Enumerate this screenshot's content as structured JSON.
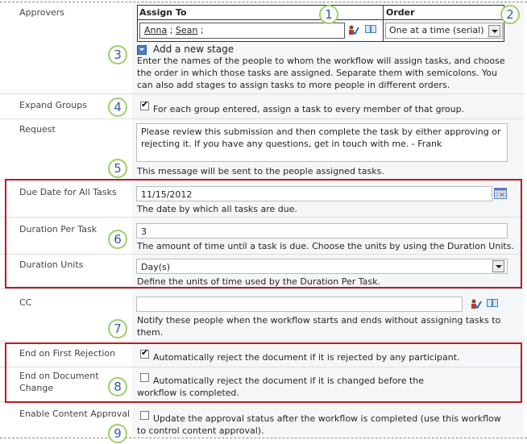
{
  "approvers": {
    "label": "Approvers",
    "table": {
      "assign_to_header": "Assign To",
      "order_header": "Order",
      "assignees": [
        "Anna",
        "Sean"
      ],
      "separator": " ; ",
      "order_value": "One at a time (serial)"
    },
    "add_stage_label": "Add a new stage",
    "description": "Enter the names of the people to whom the workflow will assign tasks, and choose the order in which those tasks are assigned. Separate them with semicolons. You can also add stages to assign tasks to more people in different orders."
  },
  "expand_groups": {
    "label": "Expand Groups",
    "checked": true,
    "text": "For each group entered, assign a task to every member of that group."
  },
  "request": {
    "label": "Request",
    "value": "Please review this submission and then complete the task by either approving or rejecting it. If you have any questions, get in touch with me. - Frank",
    "description": "This message will be sent to the people assigned tasks."
  },
  "due_date": {
    "label": "Due Date for All Tasks",
    "value": "11/15/2012",
    "description": "The date by which all tasks are due."
  },
  "duration_per_task": {
    "label": "Duration Per Task",
    "value": "3",
    "description": "The amount of time until a task is due. Choose the units by using the Duration Units."
  },
  "duration_units": {
    "label": "Duration Units",
    "value": "Day(s)",
    "description": "Define the units of time used by the Duration Per Task."
  },
  "cc": {
    "label": "CC",
    "value": "",
    "description": "Notify these people when the workflow starts and ends without assigning tasks to them."
  },
  "end_on_first_rejection": {
    "label": "End on First Rejection",
    "checked": true,
    "text": "Automatically reject the document if it is rejected by any participant."
  },
  "end_on_document_change": {
    "label": "End on Document Change",
    "checked": false,
    "text": "Automatically reject the document if it is changed before the workflow is completed."
  },
  "enable_content_approval": {
    "label": "Enable Content Approval",
    "checked": false,
    "text": "Update the approval status after the workflow is completed (use this workflow to control content approval)."
  },
  "callouts": [
    "1",
    "2",
    "3",
    "4",
    "5",
    "6",
    "7",
    "8",
    "9"
  ],
  "colors": {
    "highlight_border": "#b81c23",
    "callout_ring": "#9ccf6a",
    "callout_text": "#2d5b9a"
  }
}
